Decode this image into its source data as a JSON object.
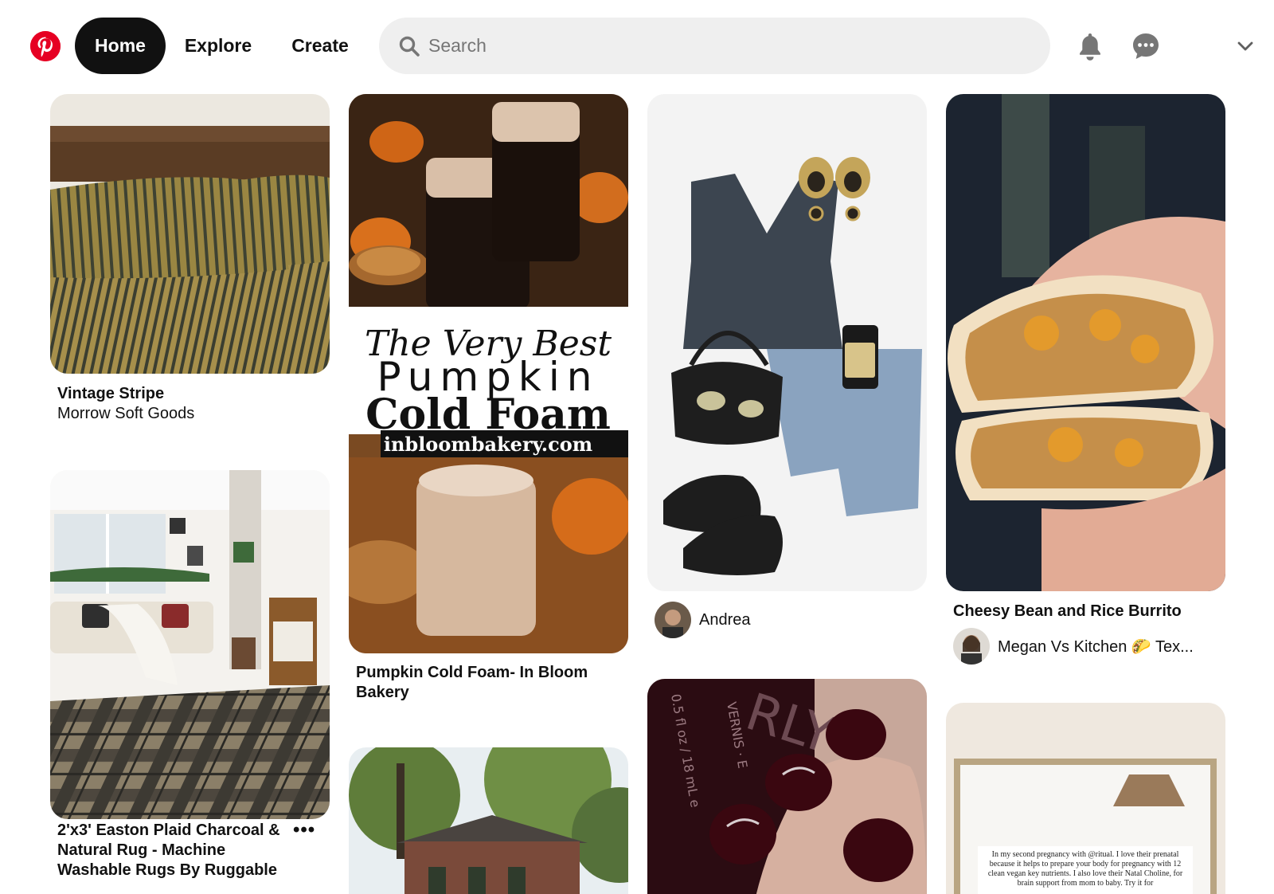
{
  "header": {
    "logo": "pinterest-logo",
    "nav": [
      {
        "label": "Home",
        "active": true
      },
      {
        "label": "Explore"
      },
      {
        "label": "Create"
      }
    ],
    "search": {
      "placeholder": "Search",
      "value": ""
    },
    "icons": [
      "bell-icon",
      "chat-icon",
      "chevron-down-icon"
    ]
  },
  "pins": [
    {
      "title": "Vintage Stripe",
      "subtitle": "Morrow Soft Goods"
    },
    {
      "title": "2'x3' Easton Plaid Charcoal & Natural Rug - Machine Washable Rugs By Ruggable",
      "more": "•••"
    },
    {
      "title": "Pumpkin Cold Foam- In Bloom Bakery",
      "image_text": {
        "script": "The Very Best",
        "line1": "Pumpkin",
        "line2": "Cold Foam",
        "url": "inbloombakery.com"
      }
    },
    {
      "title": ""
    },
    {
      "creator": "Andrea"
    },
    {
      "brand_text": "RLY",
      "bottle_text": "VERNIS · E",
      "volume_text": "0.5 fl oz / 18 mL e"
    },
    {
      "title": "Cheesy Bean and Rice Burrito",
      "creator": "Megan Vs Kitchen 🌮 Tex..."
    },
    {
      "image_text": "In my second pregnancy with @ritual. I love their prenatal because it helps to prepare your body for pregnancy with 12 clean vegan key nutrients. I also love their Natal Choline, for brain support from mom to baby. Try it for"
    }
  ],
  "colors": {
    "brand": "#e60023",
    "home_bg": "#111111",
    "search_bg": "#efefef"
  }
}
